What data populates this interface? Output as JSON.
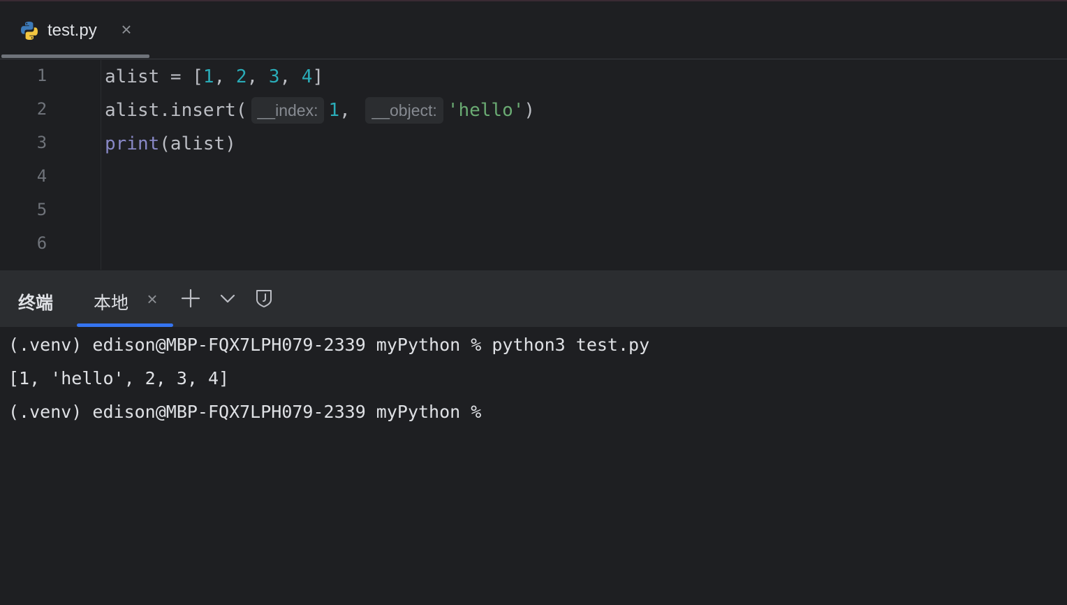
{
  "editor": {
    "tab": {
      "label": "test.py",
      "icon": "python-file-icon"
    },
    "line_numbers": [
      "1",
      "2",
      "3",
      "4",
      "5",
      "6"
    ],
    "code": {
      "line1": {
        "prefix": "alist = [",
        "n1": "1",
        "sep1": ", ",
        "n2": "2",
        "sep2": ", ",
        "n3": "3",
        "sep3": ", ",
        "n4": "4",
        "suffix": "]"
      },
      "line2": {
        "call": "alist.insert(",
        "hint1": "__index:",
        "arg1": "1",
        "comma": ", ",
        "hint2": "__object:",
        "arg2": "'hello'",
        "close": ")"
      },
      "line3": {
        "builtin": "print",
        "rest": "(alist)"
      }
    }
  },
  "terminal": {
    "title": "终端",
    "tab_label": "本地",
    "lines": [
      "(.venv) edison@MBP-FQX7LPH079-2339 myPython % python3 test.py",
      "[1, 'hello', 2, 3, 4]",
      "(.venv) edison@MBP-FQX7LPH079-2339 myPython %"
    ]
  },
  "colors": {
    "background": "#1e1f22",
    "number": "#2aacb8",
    "string": "#6aab73",
    "builtin": "#8888c6",
    "accent": "#3574f0"
  }
}
